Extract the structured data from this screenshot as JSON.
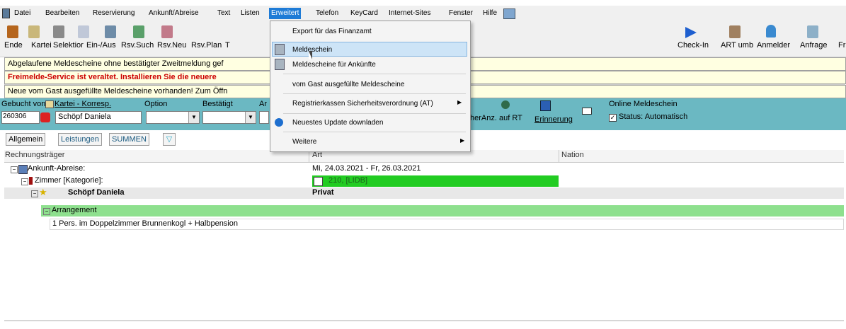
{
  "menubar": {
    "items": [
      "Datei",
      "Bearbeiten",
      "Reservierung",
      "Ankunft/Abreise",
      "Text",
      "Listen",
      "Erweitert",
      "Telefon",
      "KeyCard",
      "Internet-Sites",
      "Fenster",
      "Hilfe"
    ]
  },
  "toolbar": {
    "left_labels": [
      "Ende",
      "Kartei",
      "Selektior",
      "Ein-/Aus",
      "Rsv.Such",
      "Rsv.Neu",
      "Rsv.Plan",
      "T"
    ],
    "right_labels": [
      "Check-In",
      "ART umb",
      "Anmelder",
      "Anfrage",
      "Fr"
    ]
  },
  "info": {
    "line1": "Abgelaufene Meldescheine ohne bestätigter Zweitmeldung gef",
    "line2": "Freimelde-Service ist veraltet. Installieren Sie die neuere",
    "line3": "Neue vom Gast ausgefüllte Meldescheine vorhanden! Zum Öffn"
  },
  "guestbar": {
    "gebucht_von": "Gebucht von:",
    "kartei_link": "Kartei - Korresp.",
    "option_label": "Option",
    "bestaetigt_label": "Bestätigt",
    "ar_label": "Ar",
    "booking_no": "260306",
    "guest_name": "Schöpf Daniela",
    "anz_label": "herAnz. auf RT",
    "erinnerung_label": "Erinnerung",
    "online_label": "Online Meldeschein",
    "status_label": "Status: Automatisch"
  },
  "tabs": [
    "Allgemein",
    "Leistungen",
    "SUMMEN"
  ],
  "grid": {
    "headers": [
      "Rechnungsträger",
      "Art",
      "Nation"
    ],
    "rows": {
      "ankunft_label": "Ankunft-Abreise:",
      "ankunft_value": "Mi, 24.03.2021 - Fr, 26.03.2021",
      "zimmer_label": "Zimmer [Kategorie]:",
      "zimmer_value": "210, [LIDB]",
      "guest_name": "Schöpf Daniela",
      "guest_type": "Privat",
      "arrangement_label": "Arrangement",
      "arrangement_value": "1 Pers. im Doppelzimmer Brunnenkogl + Halbpension"
    }
  },
  "dropdown": {
    "items": [
      "Export für das Finanzamt",
      "Meldeschein",
      "Meldescheine für Ankünfte",
      "vom Gast ausgefüllte Meldescheine",
      "Registrierkassen Sicherheitsverordnung (AT)",
      "Neuestes Update downladen",
      "Weitere"
    ]
  },
  "colors": {
    "menu_highlight": "#1e7bd6",
    "teal_panel": "#6bb8c2",
    "room_green": "#22cc22",
    "arrangement_green": "#8ee08e",
    "selected_item": "#cde4f7"
  }
}
